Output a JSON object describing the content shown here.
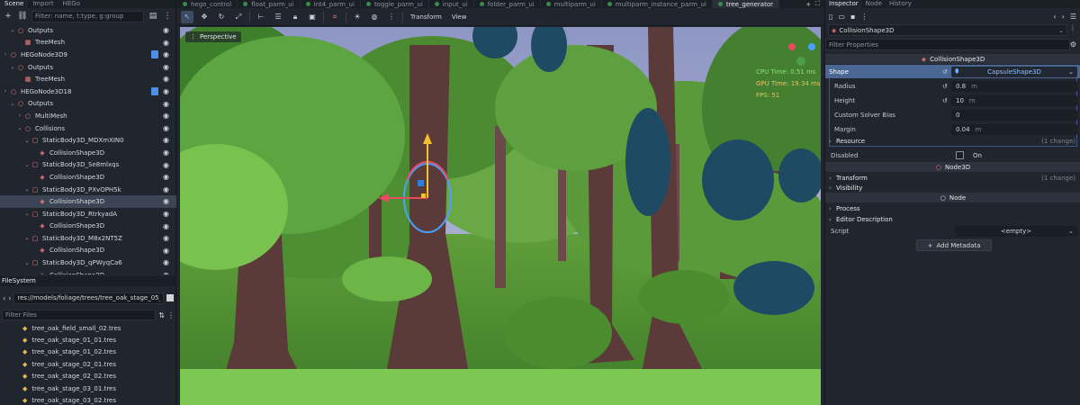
{
  "left_dock": {
    "tabs": [
      "Scene",
      "Import",
      "HEGo"
    ],
    "filter_placeholder": "Filter: name, t:type, g:group",
    "tree": [
      {
        "label": "Outputs",
        "indent": 1,
        "arrow": "v",
        "icon": "circle-red"
      },
      {
        "label": "TreeMesh",
        "indent": 2,
        "arrow": "",
        "icon": "mesh-red"
      },
      {
        "label": "HEGoNode3D9",
        "indent": 0,
        "arrow": ">",
        "icon": "circle-red",
        "script": true
      },
      {
        "label": "Outputs",
        "indent": 1,
        "arrow": "v",
        "icon": "circle-red"
      },
      {
        "label": "TreeMesh",
        "indent": 2,
        "arrow": "",
        "icon": "mesh-red"
      },
      {
        "label": "HEGoNode3D18",
        "indent": 0,
        "arrow": ">",
        "icon": "circle-red",
        "script": true
      },
      {
        "label": "Outputs",
        "indent": 1,
        "arrow": "v",
        "icon": "circle-red"
      },
      {
        "label": "MultiMesh",
        "indent": 2,
        "arrow": ">",
        "icon": "circle-red"
      },
      {
        "label": "Collisions",
        "indent": 2,
        "arrow": "v",
        "icon": "circle-red"
      },
      {
        "label": "StaticBody3D_MDXmXIN0",
        "indent": 3,
        "arrow": "v",
        "icon": "body-red"
      },
      {
        "label": "CollisionShape3D",
        "indent": 4,
        "arrow": "",
        "icon": "shape-red"
      },
      {
        "label": "StaticBody3D_Se8mlxqs",
        "indent": 3,
        "arrow": "v",
        "icon": "body-red"
      },
      {
        "label": "CollisionShape3D",
        "indent": 4,
        "arrow": "",
        "icon": "shape-red"
      },
      {
        "label": "StaticBody3D_PXvOPH5k",
        "indent": 3,
        "arrow": "v",
        "icon": "body-red"
      },
      {
        "label": "CollisionShape3D",
        "indent": 4,
        "arrow": "",
        "icon": "shape-red",
        "selected": true
      },
      {
        "label": "StaticBody3D_RtrkyadA",
        "indent": 3,
        "arrow": "v",
        "icon": "body-red"
      },
      {
        "label": "CollisionShape3D",
        "indent": 4,
        "arrow": "",
        "icon": "shape-red"
      },
      {
        "label": "StaticBody3D_M8x2NT5Z",
        "indent": 3,
        "arrow": "v",
        "icon": "body-red"
      },
      {
        "label": "CollisionShape3D",
        "indent": 4,
        "arrow": "",
        "icon": "shape-red"
      },
      {
        "label": "StaticBody3D_qPWyqCa6",
        "indent": 3,
        "arrow": "v",
        "icon": "body-red"
      },
      {
        "label": "CollisionShape3D",
        "indent": 4,
        "arrow": "",
        "icon": "shape-red"
      }
    ],
    "filesystem": {
      "title": "FileSystem",
      "path": "res://models/foliage/trees/tree_oak_stage_05_04.tr",
      "filter_placeholder": "Filter Files",
      "files": [
        "tree_oak_field_small_02.tres",
        "tree_oak_stage_01_01.tres",
        "tree_oak_stage_01_02.tres",
        "tree_oak_stage_02_01.tres",
        "tree_oak_stage_02_02.tres",
        "tree_oak_stage_03_01.tres",
        "tree_oak_stage_03_02.tres"
      ]
    }
  },
  "scene_tabs": {
    "tabs": [
      "hego_control",
      "float_parm_ui",
      "int4_parm_ui",
      "toggle_parm_ui",
      "input_ui",
      "folder_parm_ui",
      "multiparm_ui",
      "multiparm_instance_parm_ui",
      "tree_generator"
    ],
    "active": "tree_generator"
  },
  "viewport": {
    "menus": {
      "transform": "Transform",
      "view": "View"
    },
    "perspective_label": "Perspective",
    "stats": {
      "cpu": "CPU Time: 0.51 ms",
      "gpu": "GPU Time: 19.34 ms",
      "fps": "FPS: 51"
    },
    "colors": {
      "sky": "#9fa9c9",
      "grass": "#5f9e3a",
      "trunk": "#5b3a3a",
      "canopy": "#4a8a2e",
      "gizmo_x": "#e84a5f",
      "gizmo_y": "#f2c12e",
      "gizmo_z": "#4aa0ff"
    }
  },
  "inspector": {
    "tabs": [
      "Inspector",
      "Node",
      "History"
    ],
    "object": "CollisionShape3D",
    "filter_placeholder": "Filter Properties",
    "section_collision": "CollisionShape3D",
    "shape": {
      "label": "Shape",
      "value": "CapsuleShape3D"
    },
    "radius": {
      "label": "Radius",
      "value": "0.8",
      "unit": "m"
    },
    "height": {
      "label": "Height",
      "value": "10",
      "unit": "m"
    },
    "custom_solver_bias": {
      "label": "Custom Solver Bias",
      "value": "0"
    },
    "margin": {
      "label": "Margin",
      "value": "0.04",
      "unit": "m"
    },
    "resource": {
      "label": "Resource",
      "changes": "(1 change)"
    },
    "disabled": {
      "label": "Disabled",
      "value": "On"
    },
    "section_node3d": "Node3D",
    "transform": {
      "label": "Transform",
      "changes": "(1 change)"
    },
    "visibility": "Visibility",
    "section_node": "Node",
    "process": "Process",
    "editor_description": "Editor Description",
    "script": {
      "label": "Script",
      "value": "<empty>"
    },
    "add_metadata": "Add Metadata"
  }
}
